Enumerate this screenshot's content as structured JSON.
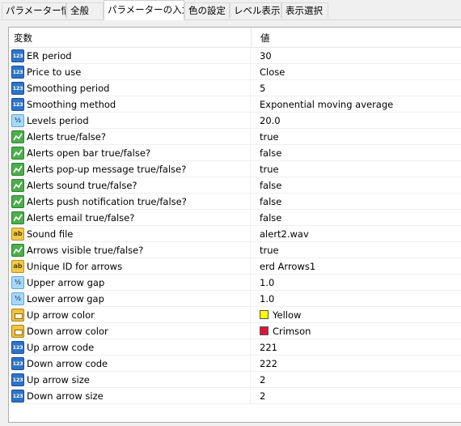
{
  "tabs": [
    {
      "label": "パラメーター情報",
      "active": false
    },
    {
      "label": "全般",
      "active": false
    },
    {
      "label": "パラメーターの入力",
      "active": true
    },
    {
      "label": "色の設定",
      "active": false
    },
    {
      "label": "レベル表示",
      "active": false
    },
    {
      "label": "表示選択",
      "active": false
    }
  ],
  "table": {
    "header": {
      "variable": "変数",
      "value": "値"
    },
    "rows": [
      {
        "icon": "int-icon",
        "name": "ER period",
        "value": "30"
      },
      {
        "icon": "int-icon",
        "name": "Price to use",
        "value": "Close"
      },
      {
        "icon": "int-icon",
        "name": "Smoothing period",
        "value": "5"
      },
      {
        "icon": "int-icon",
        "name": "Smoothing method",
        "value": "Exponential moving average"
      },
      {
        "icon": "double-icon",
        "name": "Levels period",
        "value": "20.0"
      },
      {
        "icon": "bool-icon",
        "name": "Alerts true/false?",
        "value": "true"
      },
      {
        "icon": "bool-icon",
        "name": "Alerts open bar true/false?",
        "value": "false"
      },
      {
        "icon": "bool-icon",
        "name": "Alerts pop-up message true/false?",
        "value": "true"
      },
      {
        "icon": "bool-icon",
        "name": "Alerts sound true/false?",
        "value": "false"
      },
      {
        "icon": "bool-icon",
        "name": "Alerts push notification true/false?",
        "value": "false"
      },
      {
        "icon": "bool-icon",
        "name": "Alerts email true/false?",
        "value": "false"
      },
      {
        "icon": "string-icon",
        "name": "Sound file",
        "value": "alert2.wav"
      },
      {
        "icon": "bool-icon",
        "name": "Arrows visible true/false?",
        "value": "true"
      },
      {
        "icon": "string-icon",
        "name": "Unique ID for arrows",
        "value": "erd Arrows1"
      },
      {
        "icon": "double-icon",
        "name": "Upper arrow gap",
        "value": "1.0"
      },
      {
        "icon": "double-icon",
        "name": "Lower arrow gap",
        "value": "1.0"
      },
      {
        "icon": "color-icon",
        "name": "Up arrow color",
        "value": "Yellow",
        "swatch": "#ffff00"
      },
      {
        "icon": "color-icon",
        "name": "Down arrow color",
        "value": "Crimson",
        "swatch": "#dc143c"
      },
      {
        "icon": "int-icon",
        "name": "Up arrow code",
        "value": "221"
      },
      {
        "icon": "int-icon",
        "name": "Down arrow code",
        "value": "222"
      },
      {
        "icon": "int-icon",
        "name": "Up arrow size",
        "value": "2"
      },
      {
        "icon": "int-icon",
        "name": "Down arrow size",
        "value": "2"
      }
    ]
  },
  "icon_glyphs": {
    "int": "123",
    "double": "½",
    "string": "ab"
  }
}
